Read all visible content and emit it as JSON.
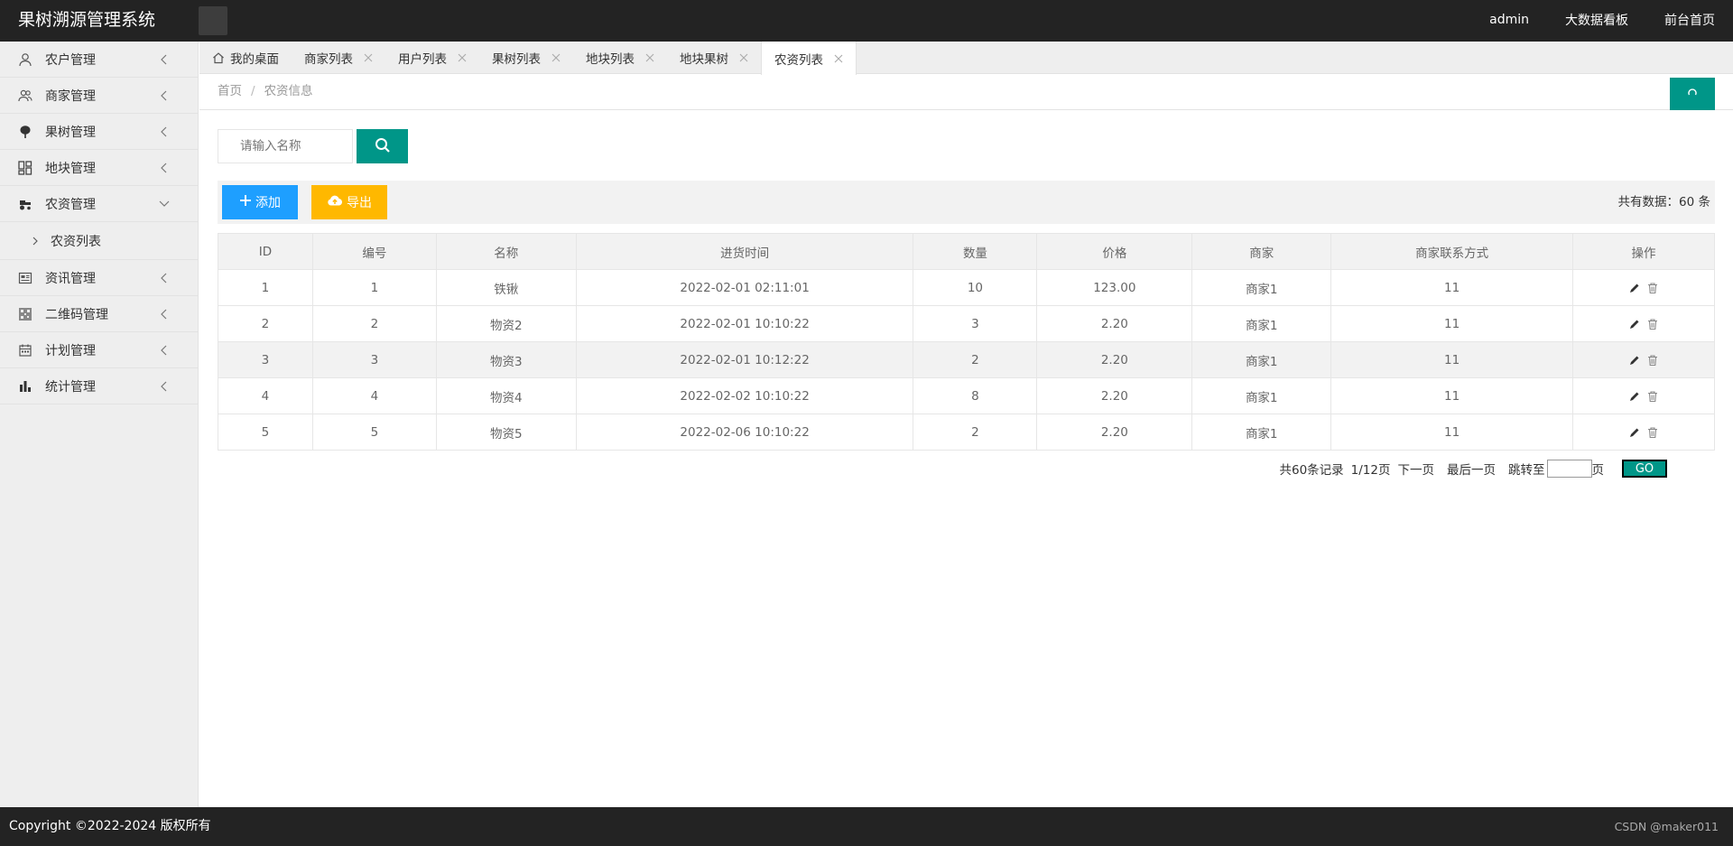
{
  "header": {
    "title": "果树溯源管理系统",
    "links": [
      "admin",
      "大数据看板",
      "前台首页"
    ]
  },
  "sidebar": {
    "items": [
      {
        "label": "农户管理",
        "icon": "user-icon"
      },
      {
        "label": "商家管理",
        "icon": "users-icon"
      },
      {
        "label": "果树管理",
        "icon": "tree-icon"
      },
      {
        "label": "地块管理",
        "icon": "blocks-icon"
      },
      {
        "label": "农资管理",
        "icon": "tractor-icon",
        "expanded": true
      },
      {
        "label": "资讯管理",
        "icon": "news-icon"
      },
      {
        "label": "二维码管理",
        "icon": "qrcode-icon"
      },
      {
        "label": "计划管理",
        "icon": "plan-icon"
      },
      {
        "label": "统计管理",
        "icon": "chart-icon"
      }
    ],
    "sub_items": [
      "农资列表"
    ]
  },
  "tabs": [
    {
      "label": "我的桌面",
      "closable": false
    },
    {
      "label": "商家列表",
      "closable": true
    },
    {
      "label": "用户列表",
      "closable": true
    },
    {
      "label": "果树列表",
      "closable": true
    },
    {
      "label": "地块列表",
      "closable": true
    },
    {
      "label": "地块果树",
      "closable": true
    },
    {
      "label": "农资列表",
      "closable": true,
      "active": true
    }
  ],
  "breadcrumb": {
    "home": "首页",
    "sep": "/",
    "current": "农资信息"
  },
  "search": {
    "placeholder": "请输入名称"
  },
  "toolbar": {
    "add_label": "添加",
    "export_label": "导出",
    "total_text": "共有数据：60 条"
  },
  "table": {
    "columns": [
      "ID",
      "编号",
      "名称",
      "进货时间",
      "数量",
      "价格",
      "商家",
      "商家联系方式",
      "操作"
    ],
    "rows": [
      [
        "1",
        "1",
        "铁锹",
        "2022-02-01 02:11:01",
        "10",
        "123.00",
        "商家1",
        "11"
      ],
      [
        "2",
        "2",
        "物资2",
        "2022-02-01 10:10:22",
        "3",
        "2.20",
        "商家1",
        "11"
      ],
      [
        "3",
        "3",
        "物资3",
        "2022-02-01 10:12:22",
        "2",
        "2.20",
        "商家1",
        "11"
      ],
      [
        "4",
        "4",
        "物资4",
        "2022-02-02 10:10:22",
        "8",
        "2.20",
        "商家1",
        "11"
      ],
      [
        "5",
        "5",
        "物资5",
        "2022-02-06 10:10:22",
        "2",
        "2.20",
        "商家1",
        "11"
      ]
    ]
  },
  "pager": {
    "records": "共60条记录",
    "pages": "1/12页",
    "next": "下一页",
    "last": "最后一页",
    "jump_label": "跳转至",
    "page_unit": "页",
    "go": "GO"
  },
  "footer": {
    "copyright": "Copyright ©2022-2024 版权所有",
    "watermark": "CSDN @maker011"
  },
  "colors": {
    "primary": "#009688",
    "blue": "#1e9fff",
    "yellow": "#ffb800",
    "header": "#232323"
  }
}
